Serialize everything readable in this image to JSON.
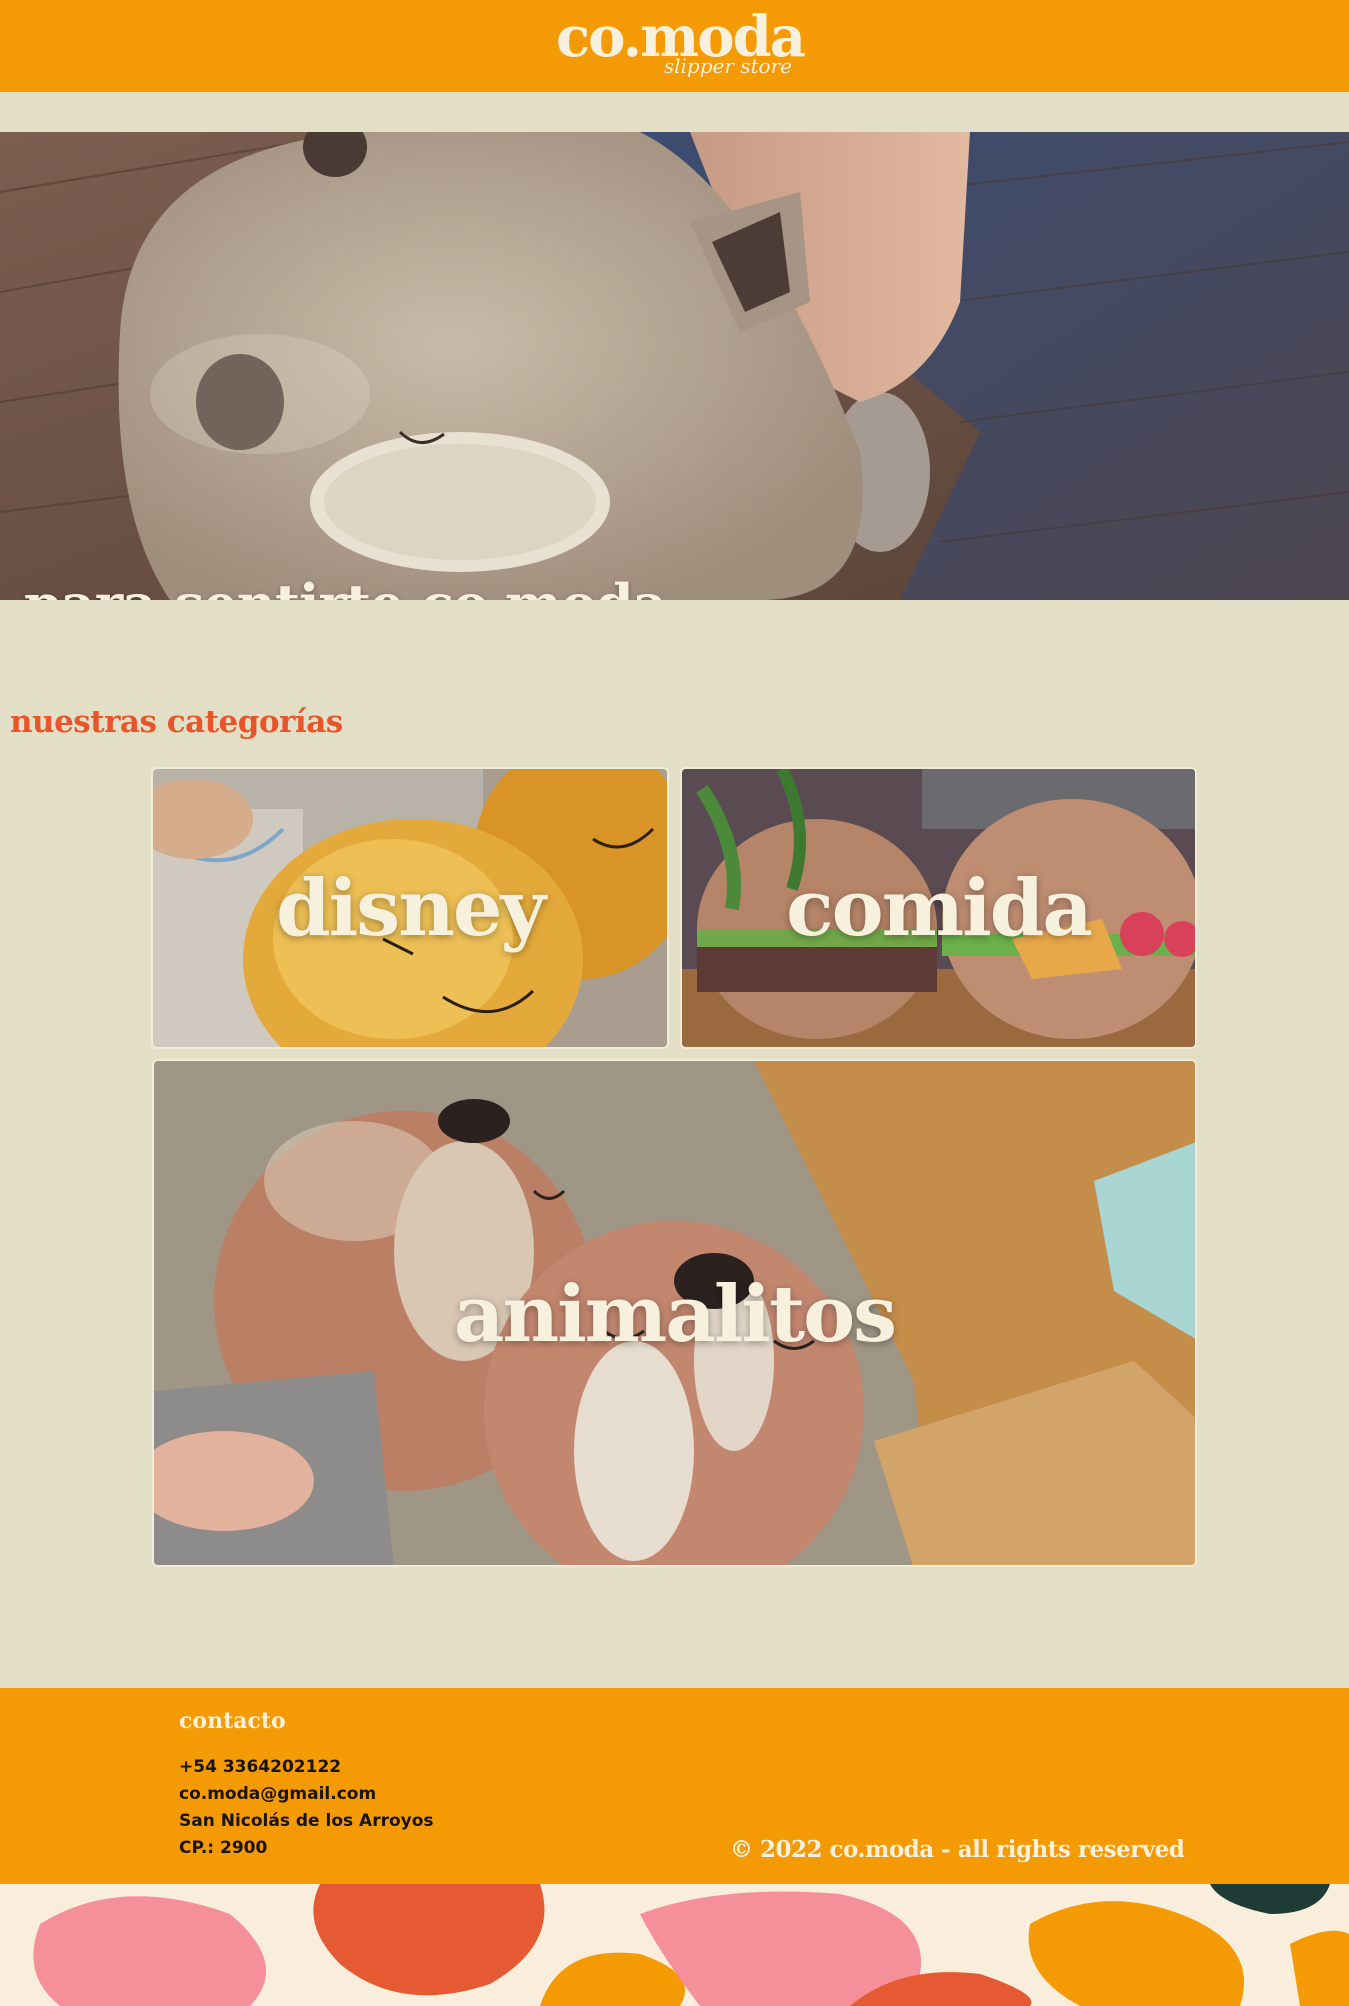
{
  "header": {
    "logo_word": "co.moda",
    "logo_tagline": "slipper store"
  },
  "hero": {
    "title": "para sentirte co.moda"
  },
  "categories": {
    "title": "nuestras categorías",
    "items": [
      {
        "label": "disney"
      },
      {
        "label": "comida"
      },
      {
        "label": "animalitos"
      }
    ]
  },
  "footer": {
    "contact_title": "contacto",
    "phone": "+54 3364202122",
    "email": "co.moda@gmail.com",
    "city": "San Nicolás de los Arroyos",
    "postal_code": "CP.: 2900",
    "copyright": "© 2022 co.moda - all rights reserved"
  },
  "colors": {
    "brand_orange": "#f49a05",
    "cream_background": "#e3dfc6",
    "accent_red": "#e8552a",
    "light_text": "#f7f0dd"
  }
}
